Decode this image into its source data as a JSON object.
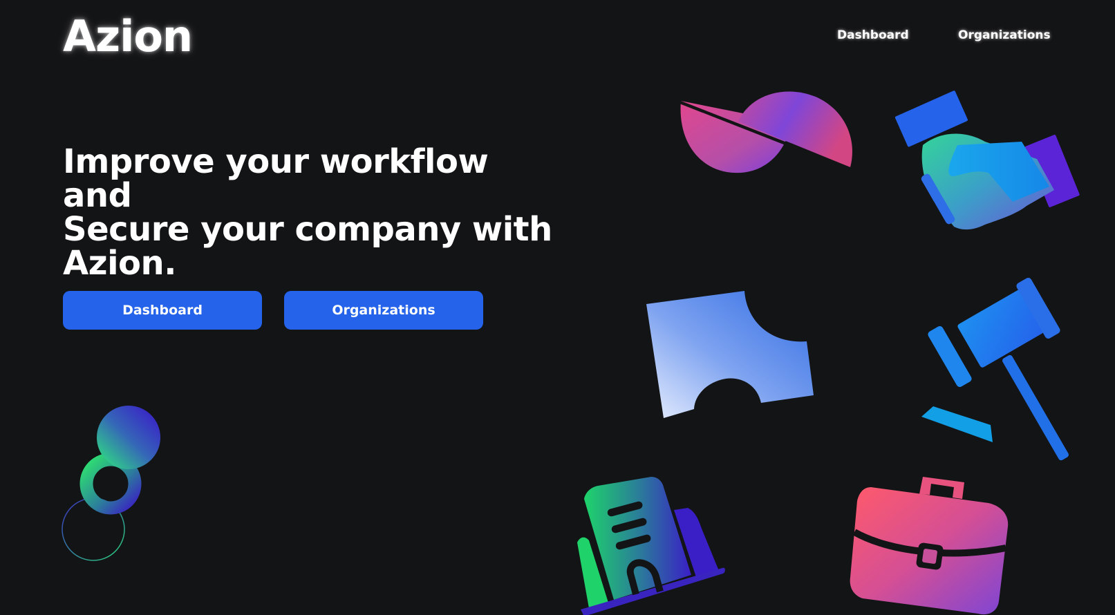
{
  "header": {
    "brand": "Azion",
    "nav": {
      "dashboard_label": "Dashboard",
      "organizations_label": "Organizations"
    }
  },
  "hero": {
    "headline_lines": [
      "Improve your workflow and",
      "Secure your company with",
      "Azion."
    ],
    "buttons": {
      "dashboard_label": "Dashboard",
      "organizations_label": "Organizations"
    }
  },
  "illustrations": [
    "split-circle-icon",
    "handshake-icon",
    "puzzle-piece-icon",
    "gavel-icon",
    "orbs-decoration",
    "office-building-icon",
    "briefcase-icon"
  ],
  "colors": {
    "background": "#131415",
    "primary_button": "#2563eb",
    "text": "#ffffff"
  }
}
